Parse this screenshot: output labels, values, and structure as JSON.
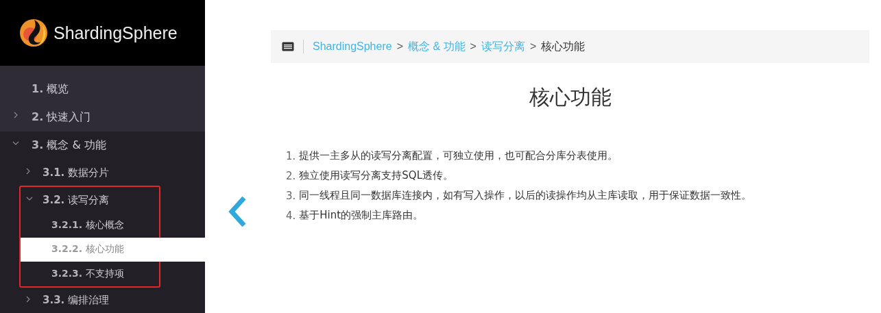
{
  "logo": {
    "text": "ShardingSphere"
  },
  "sidebar": {
    "items": [
      {
        "label": "**1.** 概览",
        "selected": false,
        "highlighted": false
      },
      {
        "label": "**2.** 快速入门",
        "expanded": false,
        "selected": false,
        "highlighted": false
      },
      {
        "label": "**3.** 概念 & 功能",
        "expanded": true,
        "selected": false,
        "highlighted": false,
        "children": [
          {
            "label": "**3.1.** 数据分片",
            "expanded": false,
            "selected": false,
            "highlighted": false
          },
          {
            "label": "**3.2.** 读写分离",
            "expanded": true,
            "selected": false,
            "highlighted": true,
            "children": [
              {
                "label": "**3.2.1.** 核心概念",
                "selected": false,
                "highlighted": false
              },
              {
                "label": "**3.2.2.** 核心功能",
                "selected": true,
                "highlighted": false
              },
              {
                "label": "**3.2.3.** 不支持项",
                "selected": false,
                "highlighted": false
              }
            ]
          },
          {
            "label": "**3.3.** 编排治理",
            "expanded": false,
            "selected": false,
            "highlighted": false
          }
        ]
      }
    ]
  },
  "breadcrumb": [
    {
      "label": "ShardingSphere",
      "link": true
    },
    {
      "label": "概念 & 功能",
      "link": true
    },
    {
      "label": "读写分离",
      "link": true
    },
    {
      "label": "核心功能",
      "link": false
    }
  ],
  "separator": ">",
  "title": "核心功能",
  "list": [
    {
      "number": "1.",
      "text": "提供一主多从的读写分离配置，可独立使用，也可配合分库分表使用。"
    },
    {
      "number": "2.",
      "text": "独立使用读写分离支持SQL透传。"
    },
    {
      "number": "3.",
      "text": "同一线程且同一数据库连接内，如有写入操作，以后的读操作均从主库读取，用于保证数据一致性。"
    },
    {
      "number": "4.",
      "text": "基于Hint的强制主库路由。"
    }
  ]
}
